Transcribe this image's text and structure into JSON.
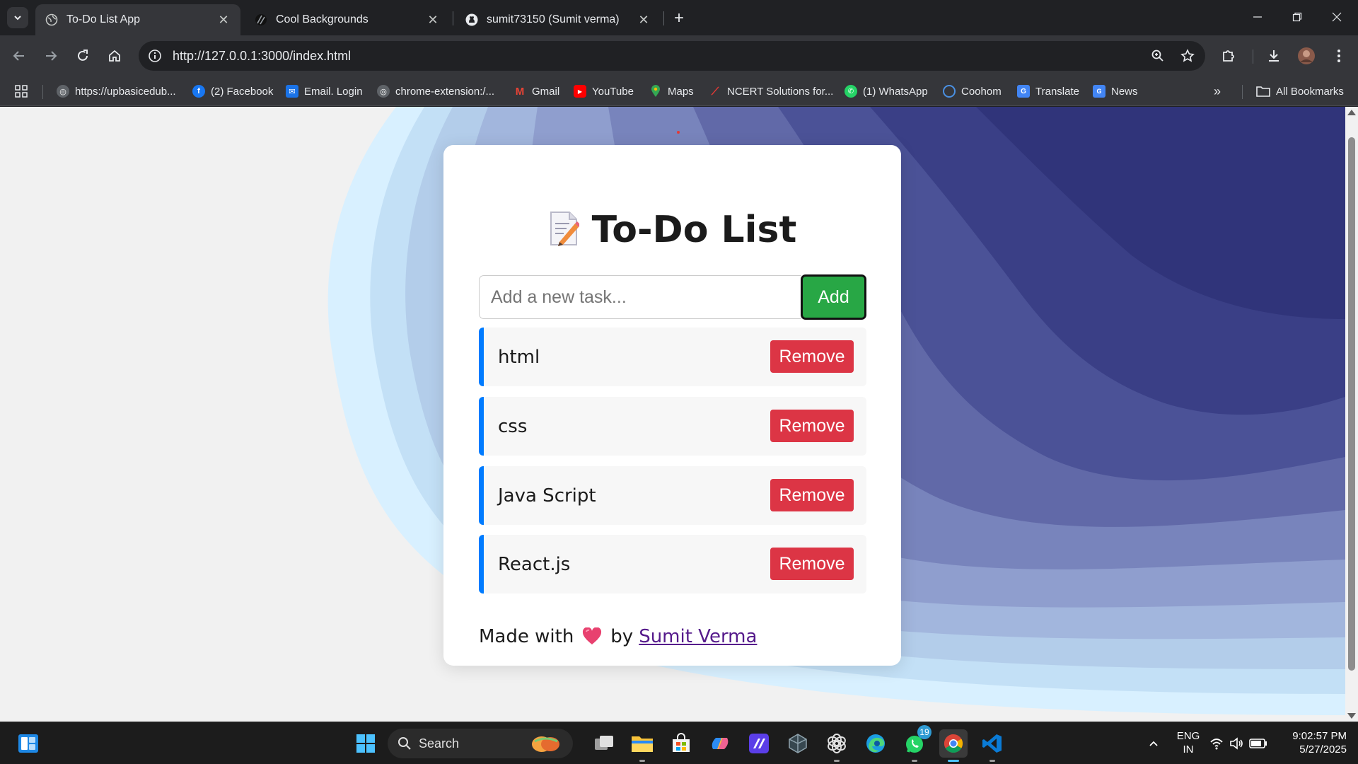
{
  "browser": {
    "tabs": [
      {
        "title": "To-Do List App",
        "active": true
      },
      {
        "title": "Cool Backgrounds",
        "active": false
      },
      {
        "title": "sumit73150 (Sumit verma)",
        "active": false
      }
    ],
    "url": "http://127.0.0.1:3000/index.html",
    "bookmarks": [
      {
        "label": "https://upbasicedub...",
        "icon": "globe-icon"
      },
      {
        "label": "(2) Facebook",
        "icon": "facebook-icon"
      },
      {
        "label": "Email. Login",
        "icon": "mail-icon"
      },
      {
        "label": "chrome-extension:/...",
        "icon": "globe-icon"
      },
      {
        "label": "Gmail",
        "icon": "gmail-icon"
      },
      {
        "label": "YouTube",
        "icon": "youtube-icon"
      },
      {
        "label": "Maps",
        "icon": "maps-icon"
      },
      {
        "label": "NCERT Solutions for...",
        "icon": "ncert-icon"
      },
      {
        "label": "(1) WhatsApp",
        "icon": "whatsapp-icon"
      },
      {
        "label": "Coohom",
        "icon": "coohom-icon"
      },
      {
        "label": "Translate",
        "icon": "translate-icon"
      },
      {
        "label": "News",
        "icon": "news-icon"
      }
    ],
    "all_bookmarks_label": "All Bookmarks"
  },
  "app": {
    "title": "To-Do List",
    "input_placeholder": "Add a new task...",
    "add_label": "Add",
    "tasks": [
      {
        "text": "html",
        "remove_label": "Remove"
      },
      {
        "text": "css",
        "remove_label": "Remove"
      },
      {
        "text": "Java Script",
        "remove_label": "Remove"
      },
      {
        "text": "React.js",
        "remove_label": "Remove"
      }
    ],
    "footer": {
      "prefix": "Made with",
      "middle": "by",
      "author": "Sumit Verma"
    },
    "colors": {
      "add": "#28a745",
      "remove": "#dc3545",
      "task_accent": "#007bff",
      "author_link": "#551a8b"
    }
  },
  "taskbar": {
    "search_label": "Search",
    "whatsapp_badge": "19",
    "lang_top": "ENG",
    "lang_bottom": "IN",
    "time": "9:02:57 PM",
    "date": "5/27/2025"
  }
}
